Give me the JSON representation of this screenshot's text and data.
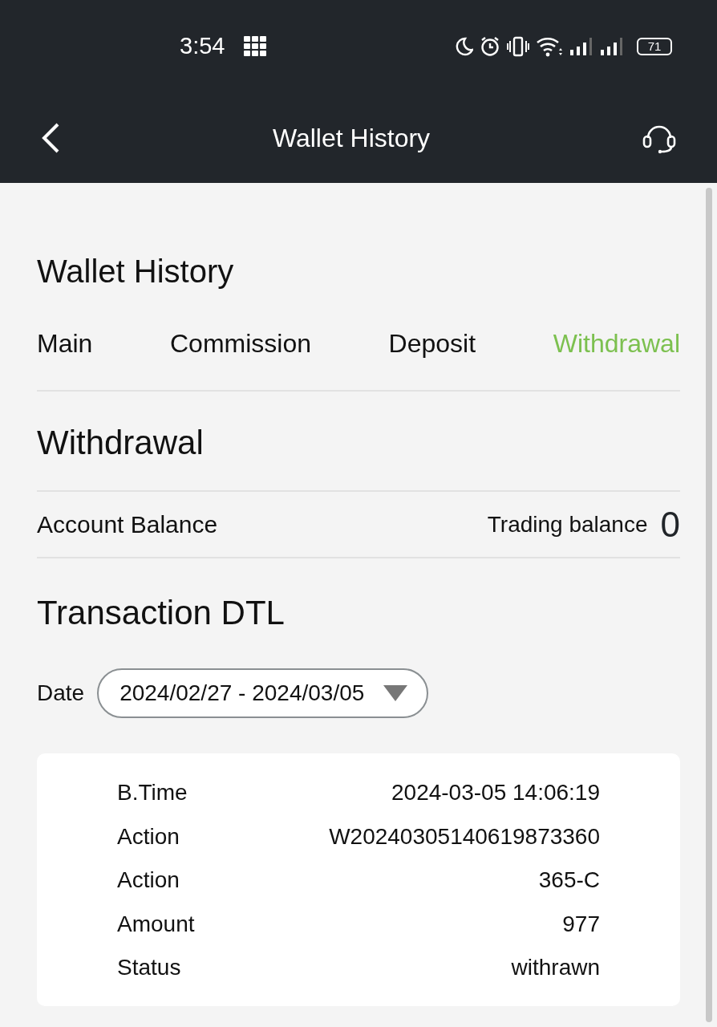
{
  "status_bar": {
    "time": "3:54",
    "battery": "71"
  },
  "header": {
    "title": "Wallet History"
  },
  "page_title": "Wallet History",
  "tabs": [
    {
      "label": "Main",
      "selected": false
    },
    {
      "label": "Commission",
      "selected": false
    },
    {
      "label": "Deposit",
      "selected": false
    },
    {
      "label": "Withdrawal",
      "selected": true
    }
  ],
  "section_title": "Withdrawal",
  "balance": {
    "label": "Account Balance",
    "trading_label": "Trading balance",
    "trading_value": "0"
  },
  "transactions_title": "Transaction DTL",
  "date_filter": {
    "label": "Date",
    "value": "2024/02/27 - 2024/03/05"
  },
  "transaction": [
    {
      "label": "B.Time",
      "value": "2024-03-05 14:06:19"
    },
    {
      "label": "Action",
      "value": "W20240305140619873360"
    },
    {
      "label": "Action",
      "value": "365-C"
    },
    {
      "label": "Amount",
      "value": "977"
    },
    {
      "label": "Status",
      "value": "withrawn"
    }
  ]
}
